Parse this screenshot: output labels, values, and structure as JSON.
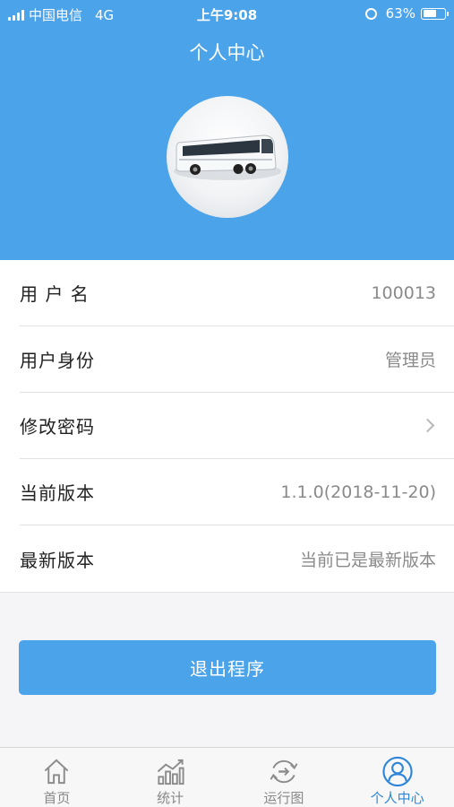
{
  "status_bar": {
    "carrier": "中国电信",
    "network": "4G",
    "time": "上午9:08",
    "battery": "63%",
    "battery_level": 0.63
  },
  "header": {
    "title": "个人中心",
    "avatar_icon": "bus-image"
  },
  "profile_rows": [
    {
      "label": "用 户 名",
      "value": "100013"
    },
    {
      "label": "用户身份",
      "value": "管理员"
    },
    {
      "label": "修改密码",
      "value": ""
    },
    {
      "label": "当前版本",
      "value": "1.1.0(2018-11-20)"
    },
    {
      "label": "最新版本",
      "value": "当前已是最新版本"
    }
  ],
  "logout_label": "退出程序",
  "tabs": [
    {
      "label": "首页",
      "icon": "home-icon",
      "active": false
    },
    {
      "label": "统计",
      "icon": "chart-icon",
      "active": false
    },
    {
      "label": "运行图",
      "icon": "route-icon",
      "active": false
    },
    {
      "label": "个人中心",
      "icon": "user-icon",
      "active": true
    }
  ],
  "colors": {
    "primary": "#4ba3ea",
    "active_tab": "#2f86d8"
  }
}
